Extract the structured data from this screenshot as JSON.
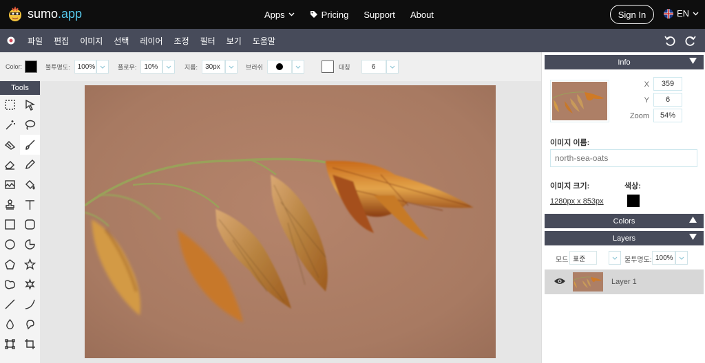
{
  "brand": {
    "name": "sumo",
    "suffix": ".app"
  },
  "topnav": {
    "links": [
      {
        "label": "Apps",
        "has_dropdown": true
      },
      {
        "label": "Pricing",
        "icon": "tag-icon"
      },
      {
        "label": "Support"
      },
      {
        "label": "About"
      }
    ],
    "signin_label": "Sign In",
    "language": "EN"
  },
  "menubar": {
    "items": [
      "파일",
      "편집",
      "이미지",
      "선택",
      "레이어",
      "조정",
      "필터",
      "보기",
      "도움말"
    ]
  },
  "options": {
    "color_label": "Color:",
    "opacity_label": "불투명도:",
    "opacity_value": "100%",
    "flow_label": "플로우:",
    "flow_value": "10%",
    "diameter_label": "지름:",
    "diameter_value": "30px",
    "brush_label": "브러쉬",
    "symmetry_label": "대칭",
    "symmetry_value": "6"
  },
  "tools": {
    "title": "Tools",
    "items": [
      "rect-select-icon",
      "pointer-icon",
      "magic-wand-icon",
      "lasso-icon",
      "heal-icon",
      "brush-icon",
      "eraser-icon",
      "pencil-icon",
      "gradient-icon",
      "fill-bucket-icon",
      "stamp-icon",
      "text-icon",
      "rectangle-icon",
      "rounded-rect-icon",
      "circle-icon",
      "pie-shape-icon",
      "pentagon-icon",
      "star-icon",
      "blob-shape-icon",
      "burst-icon",
      "line-icon",
      "curve-icon",
      "drop-icon",
      "smudge-icon",
      "transform-icon",
      "crop-icon"
    ],
    "active_index": 5
  },
  "info_panel": {
    "title": "Info",
    "x_label": "X",
    "x_value": "359",
    "y_label": "Y",
    "y_value": "6",
    "zoom_label": "Zoom",
    "zoom_value": "54%",
    "image_name_label": "이미지 이름:",
    "image_name_value": "north-sea-oats",
    "image_size_label": "이미지 크기:",
    "image_size_value": "1280px x 853px",
    "color_label": "색상:"
  },
  "colors_panel": {
    "title": "Colors"
  },
  "layers_panel": {
    "title": "Layers",
    "mode_label": "모드",
    "mode_value": "표준",
    "opacity_label": "불투명도:",
    "opacity_value": "100%",
    "layers": [
      {
        "name": "Layer 1",
        "visible": true
      }
    ]
  },
  "colors": {
    "nav_bg": "#0e0e0e",
    "menubar_bg": "#474b5a",
    "accent": "#56c7ea"
  }
}
